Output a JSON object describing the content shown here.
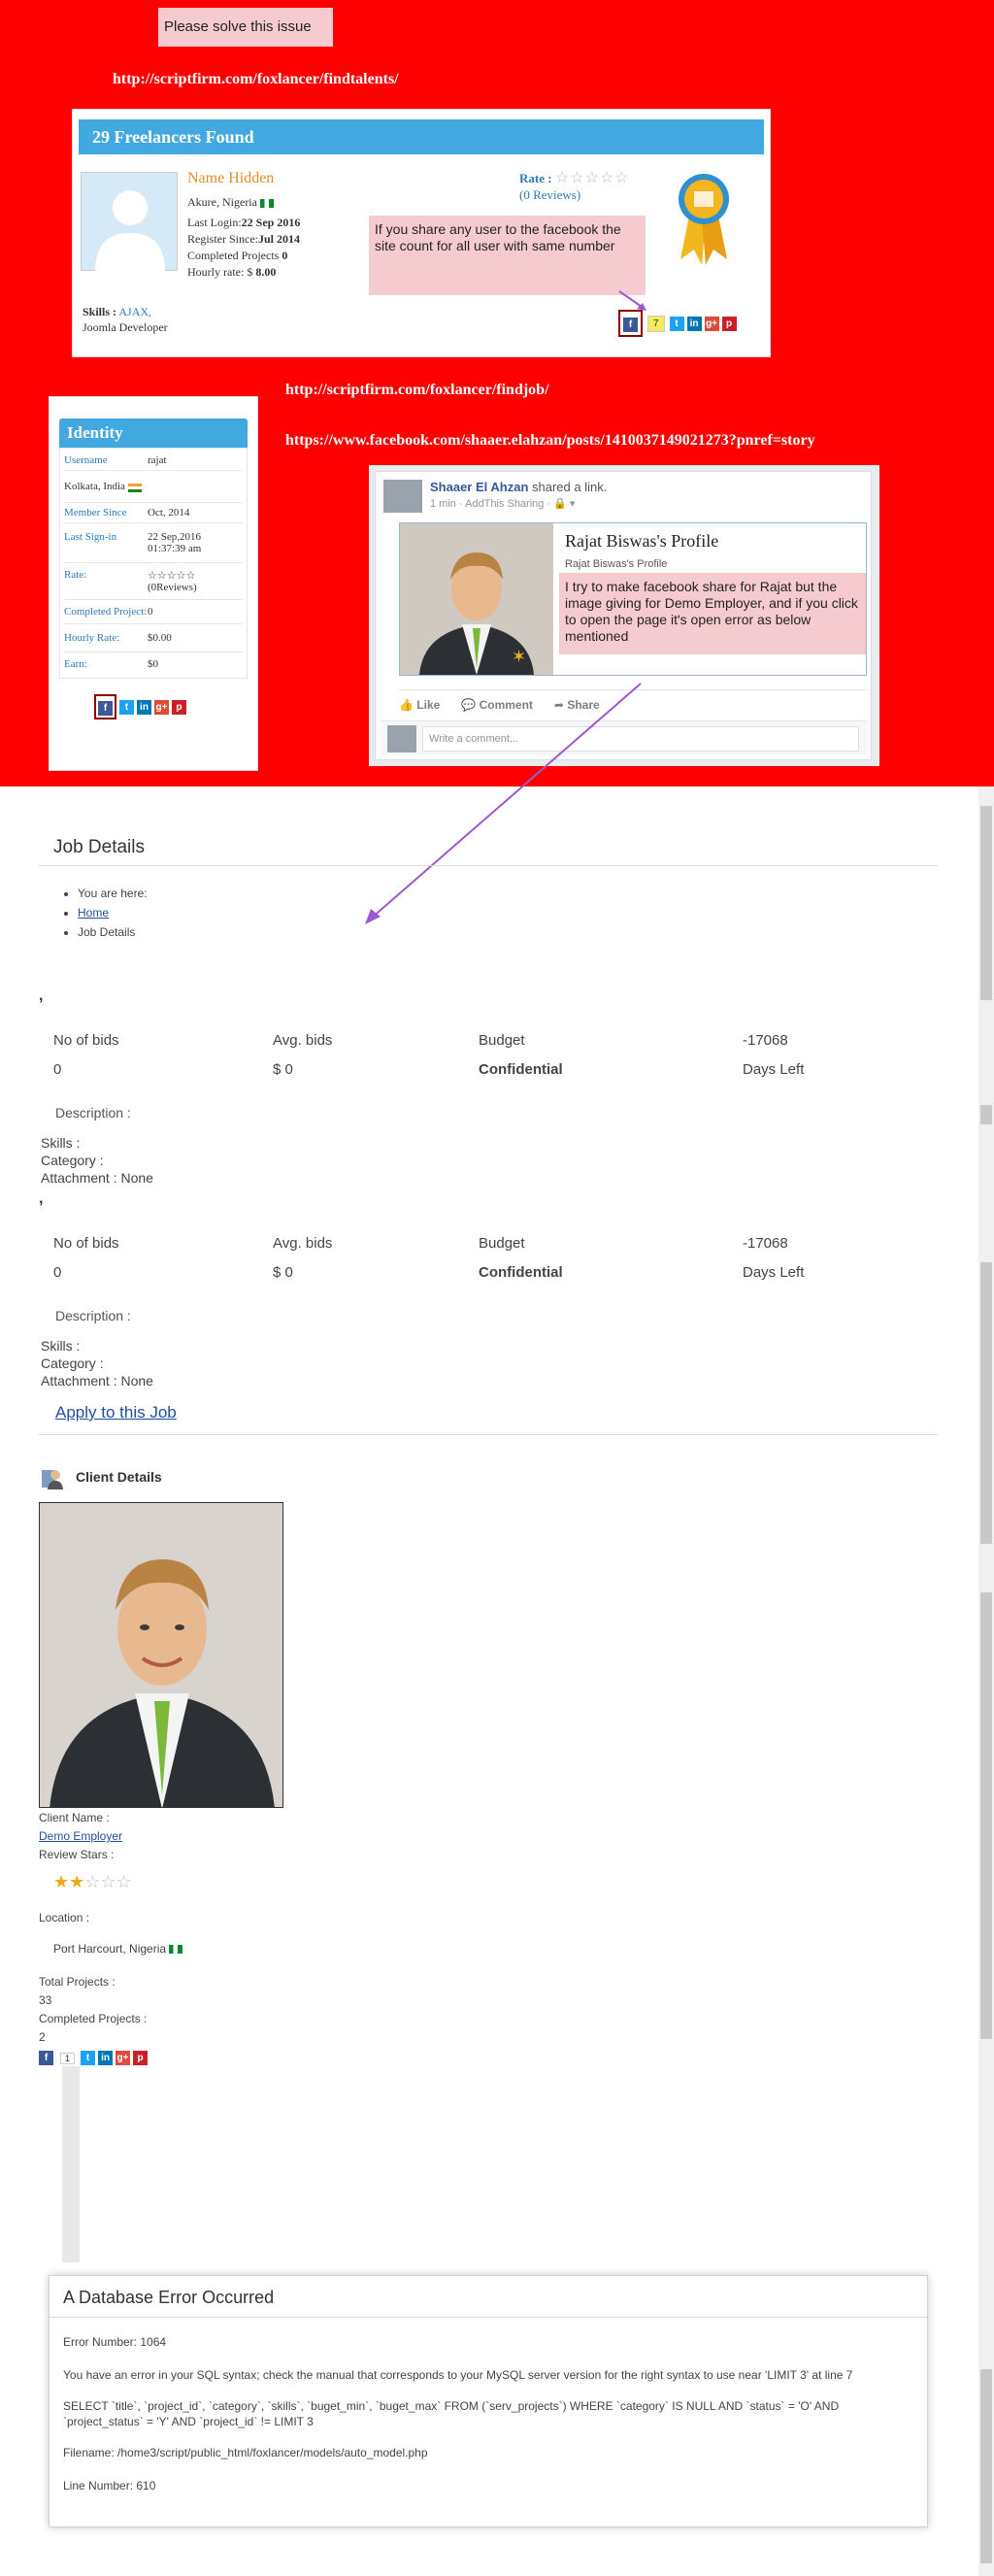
{
  "annotations": {
    "solve_note": "Please solve this issue",
    "url_find_talents": "http://scriptfirm.com/foxlancer/findtalents/",
    "url_find_job": "http://scriptfirm.com/foxlancer/findjob/",
    "url_facebook_post": "https://www.facebook.com/shaaer.elahzan/posts/1410037149021273?pnref=story",
    "share_count_note": "If you share any user to the facebook the site count for all user with same number",
    "fb_image_note": "I try to make facebook share for Rajat but the image giving for Demo Employer, and if you click to open the page it's open error as below mentioned"
  },
  "freelancers": {
    "header": "29 Freelancers Found",
    "name": "Name Hidden",
    "location": "Akure, Nigeria",
    "last_login_label": "Last Login:",
    "last_login": "22 Sep 2016",
    "register_label": "Register Since:",
    "register": "Jul 2014",
    "completed_label": "Completed Projects",
    "completed": "0",
    "hourly_label": "Hourly rate: $",
    "hourly": "8.00",
    "rate_label": "Rate :",
    "stars": "☆☆☆☆☆",
    "reviews": "(0 Reviews)",
    "skills_label": "Skills :",
    "skill_1": "AJAX,",
    "skill_2": "Joomla Developer",
    "share_count": "7"
  },
  "identity": {
    "header": "Identity",
    "rows": [
      {
        "k": "Username",
        "v": "rajat"
      },
      {
        "k": "",
        "v": "Kolkata, India"
      },
      {
        "k": "Member Since",
        "v": "Oct, 2014"
      },
      {
        "k": "Last Sign-in",
        "v": "22 Sep,2016 01:37:39 am"
      },
      {
        "k": "Rate:",
        "v": "☆☆☆☆☆ (0Reviews)"
      },
      {
        "k": "Completed Project:",
        "v": "0"
      },
      {
        "k": "Hourly Rate:",
        "v": "$0.00"
      },
      {
        "k": "Earn:",
        "v": "$0"
      }
    ]
  },
  "facebook_post": {
    "author": "Shaaer El Ahzan",
    "shared": "shared a link.",
    "meta": "1 min · AddThis Sharing · 🔒 ▾",
    "link_title": "Rajat Biswas's Profile",
    "link_sub": "Rajat Biswas's Profile",
    "like": "Like",
    "comment": "Comment",
    "share": "Share",
    "comment_placeholder": "Write a comment..."
  },
  "job": {
    "title": "Job Details",
    "breadcrumb_you_are_here": "You are here:",
    "breadcrumb_home": "Home",
    "breadcrumb_current": "Job Details",
    "comma": ",",
    "h_bids": "No of bids",
    "h_avg": "Avg. bids",
    "h_budget": "Budget",
    "h_days": "-17068",
    "v_bids": "0",
    "v_avg": "$ 0",
    "v_budget": "Confidential",
    "v_days": "Days Left",
    "description": "Description :",
    "skills": "Skills :",
    "category": "Category :",
    "attachment": "Attachment : None",
    "apply": "Apply to this Job"
  },
  "client": {
    "title": "Client Details",
    "name_label": "Client Name :",
    "name": "Demo Employer",
    "review_label": "Review Stars :",
    "stars_filled": "★★",
    "stars_empty": "☆☆☆",
    "location_label": "Location :",
    "location": "Port Harcourt, Nigeria",
    "total_label": "Total Projects :",
    "total": "33",
    "completed_label": "Completed Projects :",
    "completed": "2",
    "share_count": "1"
  },
  "db_error": {
    "title": "A Database Error Occurred",
    "number": "Error Number: 1064",
    "message": "You have an error in your SQL syntax; check the manual that corresponds to your MySQL server version for the right syntax to use near 'LIMIT 3' at line 7",
    "query": "SELECT `title`, `project_id`, `category`, `skills`, `buget_min`, `buget_max` FROM (`serv_projects`) WHERE `category` IS NULL AND `status` = 'O' AND `project_status` = 'Y' AND `project_id` != LIMIT 3",
    "filename": "Filename: /home3/script/public_html/foxlancer/models/auto_model.php",
    "line": "Line Number: 610"
  },
  "icons": {
    "facebook": "f",
    "twitter": "t",
    "linkedin": "in",
    "googleplus": "g+",
    "pinterest": "p"
  },
  "colors": {
    "annotation_red": "#ff0000",
    "accent_blue": "#42a9e0",
    "name_orange": "#e0902a",
    "arrow_purple": "#9b59d0"
  }
}
